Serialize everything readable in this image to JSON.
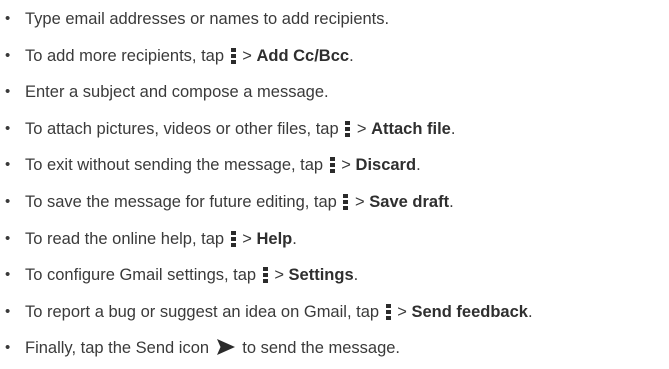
{
  "bullet_glyph": "•",
  "separator": ">",
  "items": [
    {
      "text": "Type email addresses or names to add recipients."
    },
    {
      "before": "To add more recipients, tap",
      "action": "Add Cc/Bcc",
      "after": "."
    },
    {
      "text": "Enter a subject and compose a message."
    },
    {
      "before": "To attach pictures, videos or other files, tap",
      "action": "Attach file",
      "after": "."
    },
    {
      "before": "To exit without sending the message, tap",
      "action": "Discard",
      "after": "."
    },
    {
      "before": "To save the message for future editing, tap",
      "action": "Save draft",
      "after": "."
    },
    {
      "before": "To read the online help, tap",
      "action": "Help",
      "after": "."
    },
    {
      "before": "To configure Gmail settings, tap",
      "action": "Settings",
      "after": "."
    },
    {
      "before": "To report a bug or suggest an idea on Gmail, tap",
      "action": "Send feedback",
      "after": "."
    },
    {
      "before": "Finally, tap the Send icon",
      "after": "to send the message."
    }
  ],
  "icons": {
    "menu": "overflow-menu-icon",
    "send": "send-icon"
  },
  "colors": {
    "text": "#3a3a3a",
    "icon": "#2b2b2b"
  }
}
